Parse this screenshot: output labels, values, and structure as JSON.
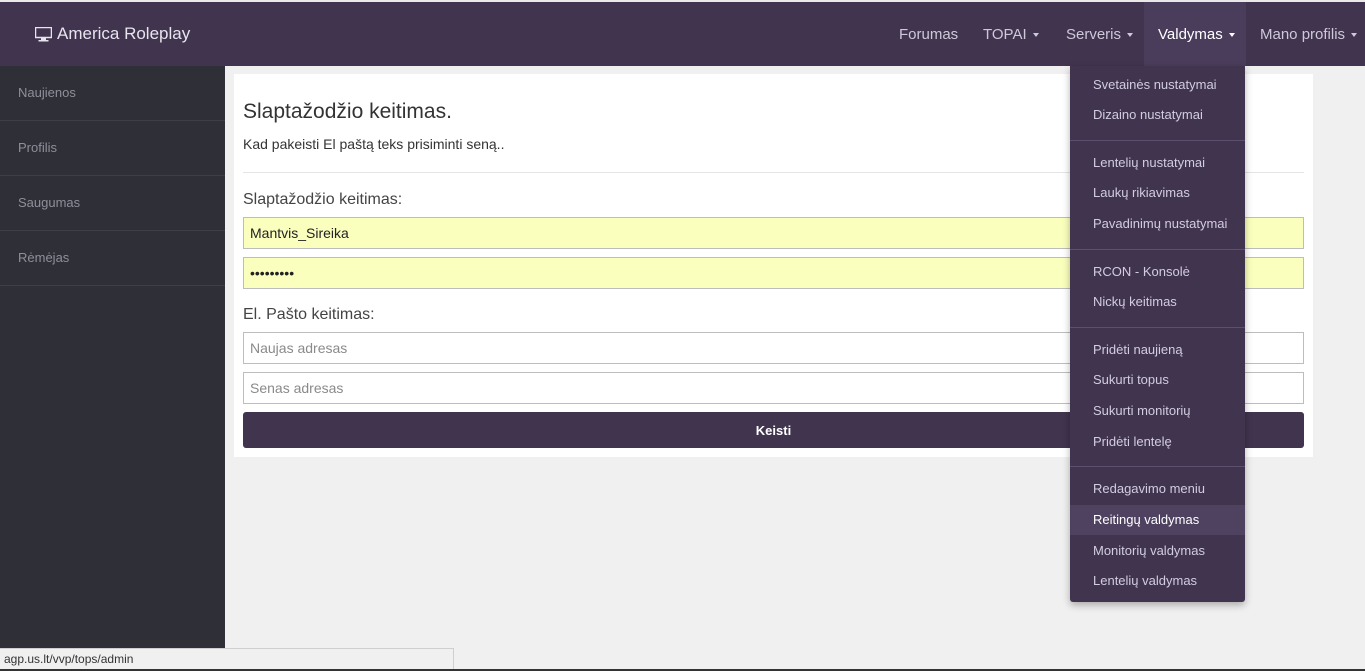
{
  "navbar": {
    "brand": "America Roleplay",
    "brand_icon": "monitor-icon",
    "items": [
      {
        "label": "Forumas",
        "dropdown": false,
        "active": false
      },
      {
        "label": "TOPAI",
        "dropdown": true,
        "active": false
      },
      {
        "label": "Serveris",
        "dropdown": true,
        "active": false
      },
      {
        "label": "Valdymas",
        "dropdown": true,
        "active": true
      },
      {
        "label": "Mano profilis",
        "dropdown": true,
        "active": false
      }
    ]
  },
  "sidebar": {
    "items": [
      "Naujienos",
      "Profilis",
      "Saugumas",
      "Rėmėjas"
    ]
  },
  "main": {
    "title": "Slaptažodžio keitimas.",
    "subtitle": "Kad pakeisti El paštą teks prisiminti seną..",
    "password_section_label": "Slaptažodžio keitimas:",
    "username_value": "Mantvis_Sireika",
    "password_value": "•••••••••",
    "email_section_label": "El. Pašto keitimas:",
    "new_email_placeholder": "Naujas adresas",
    "old_email_placeholder": "Senas adresas",
    "submit_label": "Keisti"
  },
  "dropdown": {
    "groups": [
      [
        "Svetainės nustatymai",
        "Dizaino nustatymai"
      ],
      [
        "Lentelių nustatymai",
        "Laukų rikiavimas",
        "Pavadinimų nustatymai"
      ],
      [
        "RCON - Konsolė",
        "Nickų keitimas"
      ],
      [
        "Pridėti naujieną",
        "Sukurti topus",
        "Sukurti monitorių",
        "Pridėti lentelę"
      ],
      [
        "Redagavimo meniu",
        "Reitingų valdymas",
        "Monitorių valdymas",
        "Lentelių valdymas"
      ]
    ],
    "hovered": "Reitingų valdymas"
  },
  "statusbar": {
    "url": "agp.us.lt/vvp/tops/admin"
  },
  "colors": {
    "navbar_bg": "#41344f",
    "sidebar_bg": "#2f2f38",
    "autofill_bg": "#fbffbd"
  }
}
